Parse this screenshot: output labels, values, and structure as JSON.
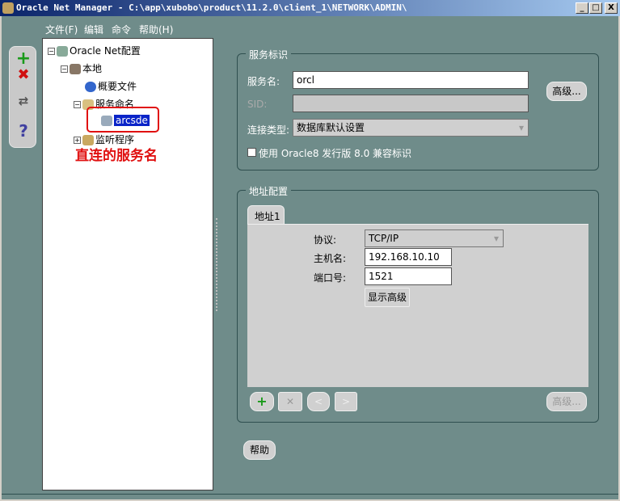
{
  "window": {
    "title": "Oracle Net Manager - C:\\app\\xubobo\\product\\11.2.0\\client_1\\NETWORK\\ADMIN\\",
    "min": "_",
    "max": "□",
    "close": "X"
  },
  "menu": [
    "文件(F)",
    "编辑",
    "命令",
    "帮助(H)"
  ],
  "toolbar": {
    "add": "+",
    "remove": "✖",
    "test": "⇄",
    "help": "?"
  },
  "tree": {
    "root": "Oracle Net配置",
    "local": "本地",
    "profile": "概要文件",
    "naming": "服务命名",
    "selected": "arcsde",
    "listeners": "监听程序"
  },
  "annotation": "直连的服务名",
  "service": {
    "legend": "服务标识",
    "name_label": "服务名:",
    "name_value": "orcl",
    "sid_label": "SID:",
    "sid_value": "",
    "conn_label": "连接类型:",
    "conn_value": "数据库默认设置",
    "advanced": "高级...",
    "compat_label": "使用 Oracle8 发行版 8.0 兼容标识"
  },
  "address": {
    "legend": "地址配置",
    "tab": "地址1",
    "protocol_label": "协议:",
    "protocol_value": "TCP/IP",
    "host_label": "主机名:",
    "host_value": "192.168.10.10",
    "port_label": "端口号:",
    "port_value": "1521",
    "show_advanced": "显示高级",
    "advanced": "高级..."
  },
  "help": "帮助"
}
